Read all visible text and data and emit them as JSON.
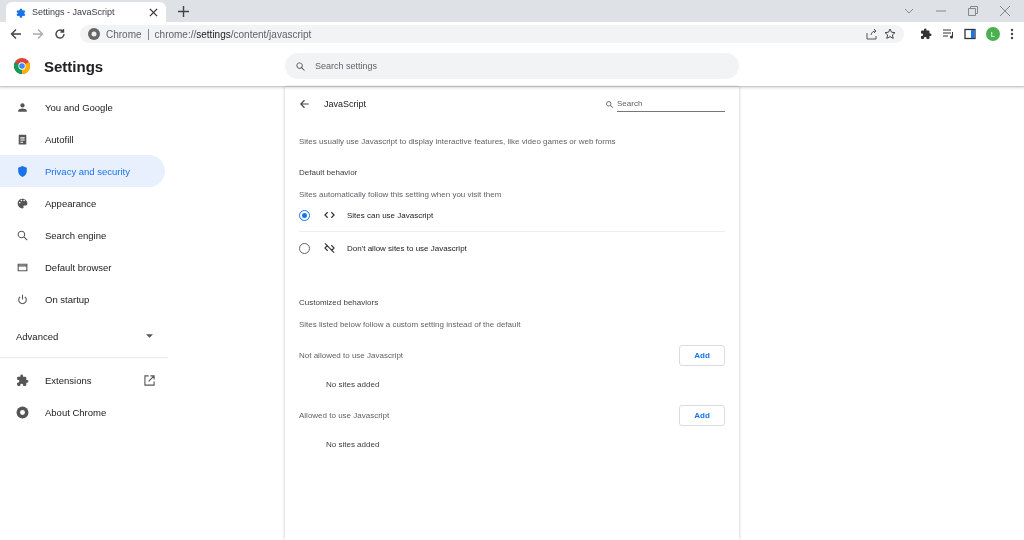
{
  "tab": {
    "title": "Settings - JavaScript",
    "selected": true
  },
  "address_bar": {
    "site_label": "Chrome",
    "url": "chrome://**settings**/content/javascript"
  },
  "profile": {
    "initial": "L"
  },
  "header": {
    "title": "Settings",
    "search": {
      "placeholder": "Search settings"
    }
  },
  "sidebar": {
    "items": [
      {
        "label": "You and Google",
        "selected": false
      },
      {
        "label": "Autofill",
        "selected": false
      },
      {
        "label": "Privacy and security",
        "selected": true
      },
      {
        "label": "Appearance",
        "selected": false
      },
      {
        "label": "Search engine",
        "selected": false
      },
      {
        "label": "Default browser",
        "selected": false
      },
      {
        "label": "On startup",
        "selected": false
      }
    ],
    "advanced": {
      "label": "Advanced",
      "expanded": false
    },
    "footer_items": [
      {
        "label": "Extensions"
      },
      {
        "label": "About Chrome"
      }
    ]
  },
  "page": {
    "title": "JavaScript",
    "search": {
      "placeholder": "Search"
    },
    "description": "Sites usually use Javascript to display interactive features, like video games or web forms",
    "default_section": {
      "heading": "Default behavior",
      "subtitle": "Sites automatically follow this setting when you visit them",
      "options": [
        {
          "label": "Sites can use Javascript",
          "selected": true
        },
        {
          "label": "Don't allow sites to use Javascript",
          "selected": false
        }
      ]
    },
    "custom_section": {
      "heading": "Customized behaviors",
      "subtitle": "Sites listed below follow a custom setting instead of the default",
      "lists": [
        {
          "title": "Not allowed to use Javascript",
          "button": "Add",
          "empty": "No sites added"
        },
        {
          "title": "Allowed to use Javascript",
          "button": "Add",
          "empty": "No sites added"
        }
      ]
    }
  }
}
